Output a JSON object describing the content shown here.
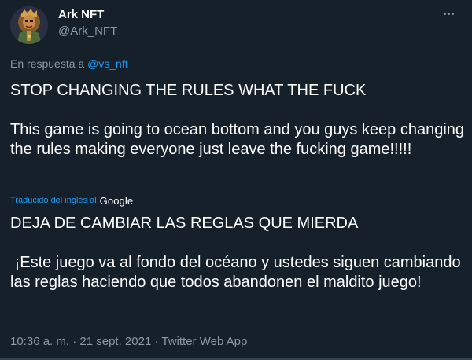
{
  "author": {
    "display_name": "Ark NFT",
    "handle": "@Ark_NFT",
    "avatar_icon": "nft-character-avatar"
  },
  "more_icon": "more-horizontal-icon",
  "reply": {
    "prefix": "En respuesta a ",
    "mention": "@vs_nft"
  },
  "tweet": {
    "original_text": "STOP CHANGING THE RULES WHAT THE FUCK\n\nThis game is going to ocean bottom and you guys keep changing the rules making everyone just leave the fucking game!!!!!",
    "translation_note": "Traducido del inglés al",
    "translation_provider": "Google",
    "translated_text": "DEJA DE CAMBIAR LAS REGLAS QUE MIERDA\n\n ¡Este juego va al fondo del océano y ustedes siguen cambiando las reglas haciendo que todos abandonen el maldito juego!"
  },
  "meta": {
    "time": "10:36 a. m.",
    "separator": "·",
    "date": "21 sept. 2021",
    "source": "Twitter Web App"
  },
  "colors": {
    "background": "#15202b",
    "accent": "#1d9bf0",
    "secondary_text": "#8b98a5",
    "primary_text": "#ffffff"
  }
}
